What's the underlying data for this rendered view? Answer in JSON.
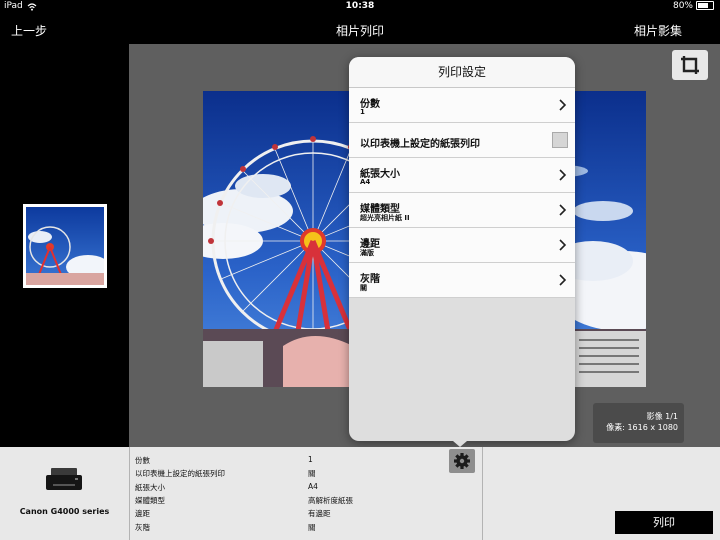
{
  "status_bar": {
    "device": "iPad",
    "time": "10:38",
    "battery": "80%"
  },
  "nav": {
    "back_label": "上一步",
    "title": "相片列印",
    "album_label": "相片影集"
  },
  "image_info": {
    "count": "影像 1/1",
    "pixels": "像素: 1616 x 1080"
  },
  "popover": {
    "title": "列印設定",
    "rows": [
      {
        "label": "份數",
        "value": "1"
      },
      {
        "label": "以印表機上設定的紙張列印"
      },
      {
        "label": "紙張大小",
        "value": "A4"
      },
      {
        "label": "媒體類型",
        "value": "超光亮相片紙 II"
      },
      {
        "label": "邊距",
        "value": "滿版"
      },
      {
        "label": "灰階",
        "value": "關"
      }
    ]
  },
  "printer": {
    "name": "Canon G4000 series"
  },
  "summary": [
    {
      "key": "份數",
      "value": "1"
    },
    {
      "key": "以印表機上設定的紙張列印",
      "value": "關"
    },
    {
      "key": "紙張大小",
      "value": "A4"
    },
    {
      "key": "媒體類型",
      "value": "高解析度紙張"
    },
    {
      "key": "邊距",
      "value": "有邊距"
    },
    {
      "key": "灰階",
      "value": "關"
    }
  ],
  "print_button": "列印",
  "colors": {
    "sky": "#1f4fb0",
    "canvas": "#5f5f5f",
    "panel": "#e8e8e8"
  },
  "icons": [
    "wifi-icon",
    "battery-icon",
    "crop-icon",
    "chevron-right-icon",
    "gear-icon",
    "printer-icon"
  ]
}
